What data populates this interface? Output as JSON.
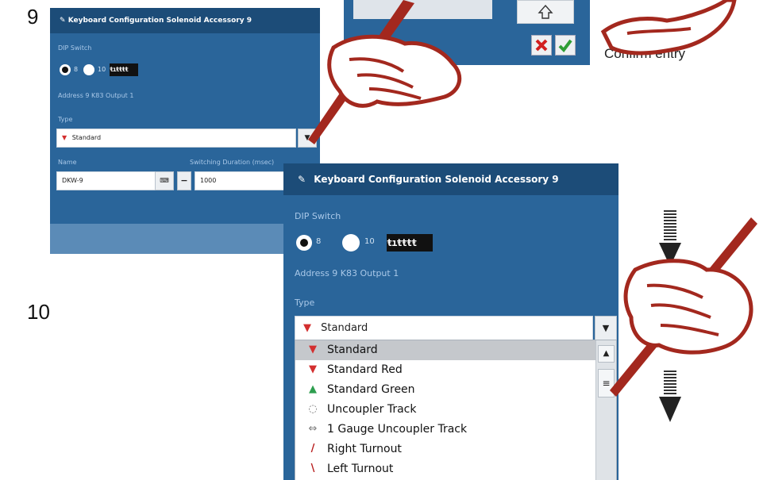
{
  "steps": {
    "step9": "9",
    "step10": "10"
  },
  "top_dialog": {
    "caption": "Confirm entry"
  },
  "panel9": {
    "title": "Keyboard Configuration Solenoid Accessory 9",
    "dip_label": "DIP Switch",
    "radio1": "8",
    "radio2": "10",
    "address_line": "Address 9    K83 Output 1",
    "type_label": "Type",
    "type_value": "Standard",
    "name_label": "Name",
    "duration_label": "Switching Duration (msec)",
    "name_value": "DKW-9",
    "duration_value": "1000",
    "minus": "−"
  },
  "panel10": {
    "title": "Keyboard Configuration Solenoid Accessory 9",
    "dip_label": "DIP Switch",
    "radio1": "8",
    "radio2": "10",
    "address_line": "Address 9    K83 Output 1",
    "type_label": "Type",
    "type_value": "Standard",
    "options": [
      {
        "label": "Standard",
        "icon": "standard-signal-icon",
        "color": "#d32f2f"
      },
      {
        "label": "Standard Red",
        "icon": "standard-red-icon",
        "color": "#d32f2f"
      },
      {
        "label": "Standard Green",
        "icon": "standard-green-icon",
        "color": "#2e9e4f"
      },
      {
        "label": "Uncoupler Track",
        "icon": "uncoupler-track-icon",
        "color": "#777777"
      },
      {
        "label": "1 Gauge Uncoupler Track",
        "icon": "gauge-uncoupler-icon",
        "color": "#777777"
      },
      {
        "label": "Right Turnout",
        "icon": "right-turnout-icon",
        "color": "#b71c1c"
      },
      {
        "label": "Left Turnout",
        "icon": "left-turnout-icon",
        "color": "#b71c1c"
      }
    ]
  },
  "colors": {
    "panel": "#2a659a",
    "titlebar": "#1c4c78",
    "hand": "#a3281e"
  }
}
